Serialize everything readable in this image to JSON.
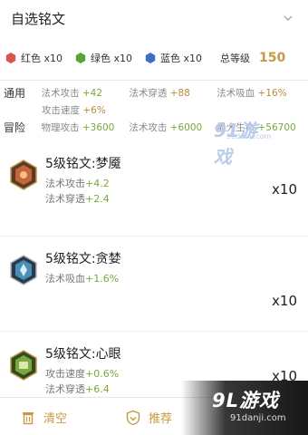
{
  "header": {
    "title": "自选铭文"
  },
  "summary": {
    "chips": [
      {
        "label": "红色 x10",
        "color": "#d9534f"
      },
      {
        "label": "绿色 x10",
        "color": "#5aa33a"
      },
      {
        "label": "蓝色 x10",
        "color": "#3a6fc4"
      }
    ],
    "level_label": "总等级",
    "level_value": "150"
  },
  "stats": [
    {
      "category": "通用",
      "cells": [
        {
          "name": "法术攻击",
          "value": "+42"
        },
        {
          "name": "法术穿透",
          "value": "+88"
        },
        {
          "name": "法术吸血",
          "value": "+16%"
        }
      ]
    },
    {
      "category": "",
      "cells": [
        {
          "name": "攻击速度",
          "value": "+6%"
        }
      ]
    },
    {
      "category": "冒险",
      "cells": [
        {
          "name": "物理攻击",
          "value": "+3600"
        },
        {
          "name": "法术攻击",
          "value": "+6000"
        },
        {
          "name": "最大生命",
          "value": "+56700"
        }
      ]
    }
  ],
  "watermark_mid": {
    "text": "91游戏",
    "sub": "91danji.com"
  },
  "items": [
    {
      "name": "5级铭文:梦魇",
      "lines": [
        {
          "label": "法术攻击",
          "value": "+4.2"
        },
        {
          "label": "法术穿透",
          "value": "+2.4"
        }
      ],
      "count": "x10",
      "color": "#c8643a"
    },
    {
      "name": "5级铭文:贪婪",
      "lines": [
        {
          "label": "法术吸血",
          "value": "+1.6%"
        }
      ],
      "count": "x10",
      "color": "#4a8fb8"
    },
    {
      "name": "5级铭文:心眼",
      "lines": [
        {
          "label": "攻击速度",
          "value": "+0.6%"
        },
        {
          "label": "法术穿透",
          "value": "+6.4"
        }
      ],
      "count": "x10",
      "color": "#7aa83a"
    }
  ],
  "bottom": {
    "clear_label": "清空",
    "recommend_label": "推荐"
  },
  "brand": {
    "logo": "9L游戏",
    "url": "91danji.com"
  }
}
